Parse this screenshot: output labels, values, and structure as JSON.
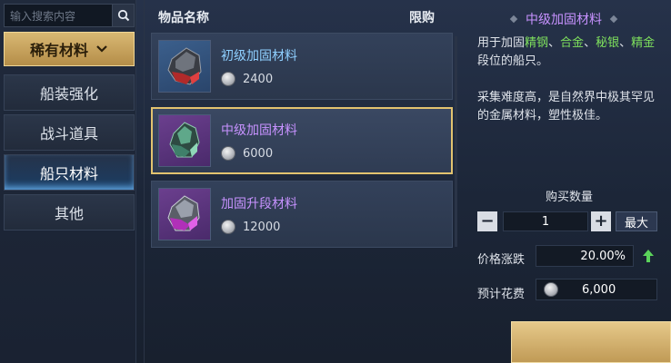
{
  "search": {
    "placeholder": "输入搜索内容"
  },
  "category": {
    "current": "稀有材料"
  },
  "sidebar": {
    "items": [
      {
        "label": "船装强化"
      },
      {
        "label": "战斗道具"
      },
      {
        "label": "船只材料"
      },
      {
        "label": "其他"
      }
    ]
  },
  "list": {
    "header_name": "物品名称",
    "header_limit": "限购",
    "items": [
      {
        "name": "初级加固材料",
        "price": "2400"
      },
      {
        "name": "中级加固材料",
        "price": "6000"
      },
      {
        "name": "加固升段材料",
        "price": "12000"
      }
    ]
  },
  "detail": {
    "title": "中级加固材料",
    "desc_prefix": "用于加固",
    "desc_hl1": "精钢",
    "desc_sep1": "、",
    "desc_hl2": "合金",
    "desc_sep2": "、",
    "desc_hl3": "秘银",
    "desc_sep3": "、",
    "desc_hl4": "精金",
    "desc_suffix": "段位的船只。",
    "desc2": "采集难度高，是自然界中极其罕见的金属材料，塑性极佳。",
    "qty_label": "购买数量",
    "qty_minus": "−",
    "qty_value": "1",
    "qty_plus": "+",
    "max_label": "最大",
    "price_change_label": "价格涨跌",
    "price_change_value": "20.00%",
    "cost_label": "预计花费",
    "cost_value": "6,000"
  },
  "colors": {
    "accent_gold": "#e2c36f",
    "rare_purple": "#c792ff",
    "highlight_green": "#7ee05d"
  },
  "icons": {
    "search": "search-icon",
    "chevron": "chevron-down-icon",
    "coin": "silver-coin-icon",
    "up": "arrow-up-icon"
  }
}
